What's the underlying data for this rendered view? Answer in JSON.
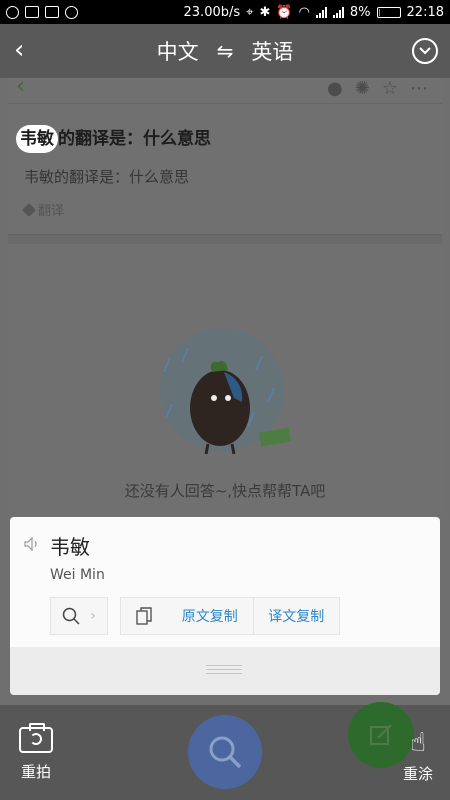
{
  "status_bar": {
    "network_speed": "23.00b/s",
    "battery_percent": "8%",
    "time": "22:18",
    "battery_level": 0.08
  },
  "header": {
    "source_lang": "中文",
    "swap_glyph": "⇋",
    "target_lang": "英语"
  },
  "background_page": {
    "question_highlight": "韦敏",
    "question_rest": "的翻译是：什么意思",
    "question_body": "韦敏的翻译是：什么意思",
    "tag": "翻译",
    "empty_message": "还没有人回答~,快点帮帮TA吧"
  },
  "result_card": {
    "source_word": "韦敏",
    "translation": "Wei Min",
    "copy_original_label": "原文复制",
    "copy_translation_label": "译文复制"
  },
  "bottom_bar": {
    "retake_label": "重拍",
    "redraw_label": "重涂"
  },
  "colors": {
    "overlay": "#6f6f6f",
    "link_blue": "#2a87c8",
    "search_fab": "#4c67a0",
    "green_fab": "#2f6a2d"
  }
}
